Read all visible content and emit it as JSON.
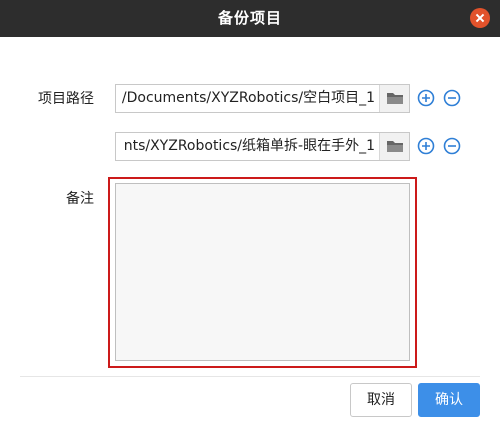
{
  "dialog": {
    "title": "备份项目"
  },
  "form": {
    "project_path_label": "项目路径",
    "paths": [
      {
        "value": "/Documents/XYZRobotics/空白项目_1"
      },
      {
        "value": "nts/XYZRobotics/纸箱单拆-眼在手外_1"
      }
    ],
    "note_label": "备注",
    "note_value": ""
  },
  "buttons": {
    "cancel": "取消",
    "confirm": "确认"
  },
  "colors": {
    "titlebar": "#2d2d2d",
    "close": "#e2522b",
    "accent": "#3d8fe8",
    "highlight": "#cc1a1a"
  }
}
